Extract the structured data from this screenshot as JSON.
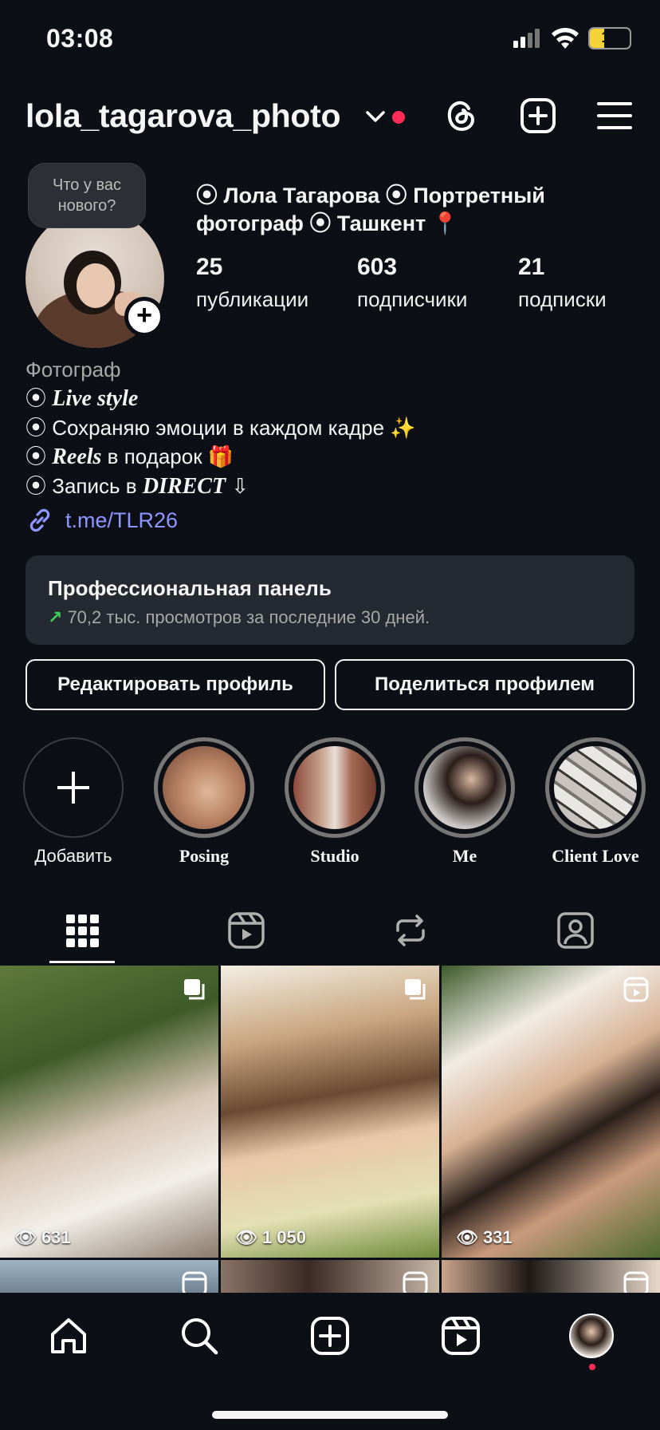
{
  "status_bar": {
    "time": "03:08",
    "battery": "10"
  },
  "header": {
    "username": "lola_tagarova_photo"
  },
  "profile": {
    "note": "Что у вас нового?",
    "display_name_line1": "⦿ Лола Тагарова ⦿ Портретный",
    "display_name_line2": "фотограф ⦿ Ташкент 📍",
    "stats": [
      {
        "value": "25",
        "label": "публикации"
      },
      {
        "value": "603",
        "label": "подписчики"
      },
      {
        "value": "21",
        "label": "подписки"
      }
    ],
    "category": "Фотограф",
    "bio": {
      "l1": "Live style",
      "l2": "Сохраняю эмоции в каждом кадре ✨",
      "l3a": "Reels",
      "l3b": " в подарок 🎁",
      "l4a": "Запись в ",
      "l4b": "DIRECT",
      "l4c": " ⇩"
    },
    "link": "t.me/TLR26"
  },
  "pro_panel": {
    "title": "Профессиональная панель",
    "arrow": "↗",
    "subtitle": "70,2 тыс. просмотров за последние 30 дней."
  },
  "buttons": {
    "edit": "Редактировать профиль",
    "share": "Поделиться профилем"
  },
  "highlights": [
    {
      "label": "Добавить"
    },
    {
      "label": "Posing"
    },
    {
      "label": "Studio"
    },
    {
      "label": "Me"
    },
    {
      "label": "Client Love"
    }
  ],
  "grid": [
    {
      "views": "631"
    },
    {
      "views": "1 050"
    },
    {
      "views": "331"
    }
  ],
  "colors": {
    "background": "#0c1016",
    "link": "#8f96ff",
    "accent_red": "#ff2d55",
    "growth_green": "#3ecf5a"
  }
}
